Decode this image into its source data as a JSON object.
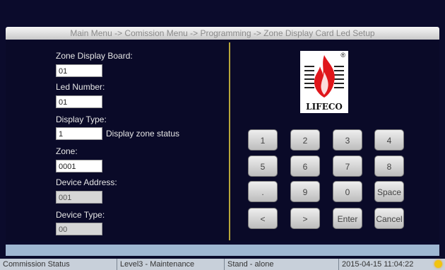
{
  "breadcrumb": "Main Menu -> Comission Menu -> Programming -> Zone Display Card Led Setup",
  "form": {
    "zone_display_board": {
      "label": "Zone Display Board:",
      "value": "01"
    },
    "led_number": {
      "label": "Led Number:",
      "value": "01"
    },
    "display_type": {
      "label": "Display Type:",
      "value": "1",
      "note": "Display zone status"
    },
    "zone": {
      "label": "Zone:",
      "value": "0001"
    },
    "device_address": {
      "label": "Device Address:",
      "value": "001"
    },
    "device_type": {
      "label": "Device Type:",
      "value": "00"
    }
  },
  "logo": {
    "text": "LIFECO",
    "mark": "®"
  },
  "keypad": {
    "keys": [
      "1",
      "2",
      "3",
      "4",
      "5",
      "6",
      "7",
      "8",
      ".",
      "9",
      "0",
      "Space",
      "<",
      ">",
      "Enter",
      "Cancel"
    ]
  },
  "status": {
    "mode": "Commission Status",
    "level": "Level3 - Maintenance",
    "standalone": "Stand - alone",
    "datetime": "2015-04-15 11:04:22"
  },
  "colors": {
    "background": "#0b0b2c",
    "divider": "#b8a63a",
    "flame": "#e0161b"
  }
}
